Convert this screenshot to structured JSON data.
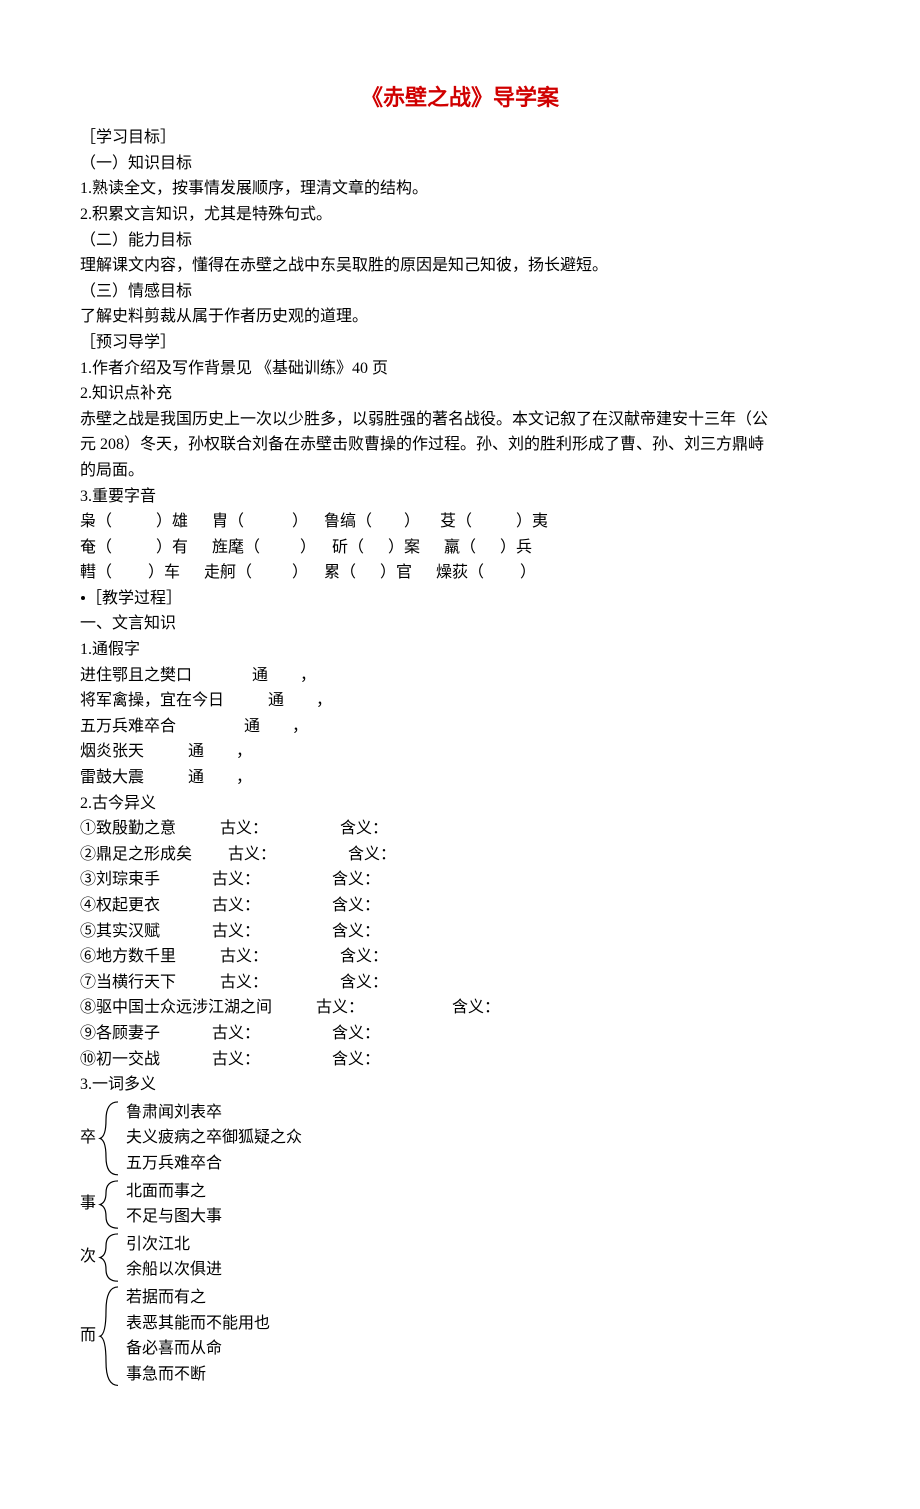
{
  "title": "《赤壁之战》导学案",
  "sections": {
    "s1": "［学习目标］",
    "s1_1": "（一）知识目标",
    "s1_1_1": "1.熟读全文，按事情发展顺序，理清文章的结构。",
    "s1_1_2": "2.积累文言知识，尤其是特殊句式。",
    "s1_2": "（二）能力目标",
    "s1_2_1": "理解课文内容，懂得在赤壁之战中东吴取胜的原因是知己知彼，扬长避短。",
    "s1_3": "（三）情感目标",
    "s1_3_1": "了解史料剪裁从属于作者历史观的道理。",
    "s2": "［预习导学］",
    "s2_1": "1.作者介绍及写作背景见 《基础训练》40 页",
    "s2_2": "2.知识点补充",
    "s2_2_p1": "赤壁之战是我国历史上一次以少胜多，以弱胜强的著名战役。本文记叙了在汉献帝建安十三年（公",
    "s2_2_p2": "元 208）冬天，孙权联合刘备在赤壁击败曹操的作过程。孙、刘的胜利形成了曹、孙、刘三方鼎峙",
    "s2_2_p3": "的局面。",
    "s2_3": "3.重要字音",
    "phon_1": "枭（           ）雄      胄（            ）    鲁缟（        ）     芟（           ）夷",
    "phon_2": "奄（           ）有      旌麾（          ）    斫（      ）案      羸（      ）兵",
    "phon_3": "轊（         ）车      走舸（          ）    累（      ）官      燥荻（         ）",
    "s3": "［教学过程］",
    "s3_1": "一、文言知识",
    "s3_1_1": "1.通假字",
    "tj_1": "进住鄂且之樊口               通        ，",
    "tj_2": "将军禽操，宜在今日           通        ，",
    "tj_3": "五万兵难卒合                 通        ，",
    "tj_4": "烟炎张天           通        ，",
    "tj_5": "雷鼓大震           通        ，",
    "s3_1_2": "2.古今异义",
    "gj_1": "①致殷勤之意           古义：                  含义：",
    "gj_2": "②鼎足之形成矣         古义：                  含义：",
    "gj_3": "③刘琮束手             古义：                  含义：",
    "gj_4": "④权起更衣             古义：                  含义：",
    "gj_5": "⑤其实汉赋             古义：                  含义：",
    "gj_6": "⑥地方数千里           古义：                  含义：",
    "gj_7": "⑦当横行天下           古义：                  含义：",
    "gj_8": "⑧驱中国士众远涉江湖之间           古义：                      含义：",
    "gj_9": "⑨各顾妻子             古义：                  含义：",
    "gj_10": "⑩初一交战             古义：                  含义：",
    "s3_1_3": "3.一词多义",
    "zu_label": "卒",
    "zu_1": "鲁肃闻刘表卒",
    "zu_2": "夫义疲病之卒御狐疑之众",
    "zu_3": "五万兵难卒合",
    "shi_label_top": "事",
    "shi_1": "北面而事之",
    "shi_2": "不足与图大事",
    "ci_label": "次",
    "ci_1": "引次江北",
    "ci_2": "余船以次俱进",
    "er_label": "而",
    "er_1": "若据而有之",
    "er_2": "表恶其能而不能用也",
    "er_3": "备必喜而从命",
    "er_4": "事急而不断"
  }
}
